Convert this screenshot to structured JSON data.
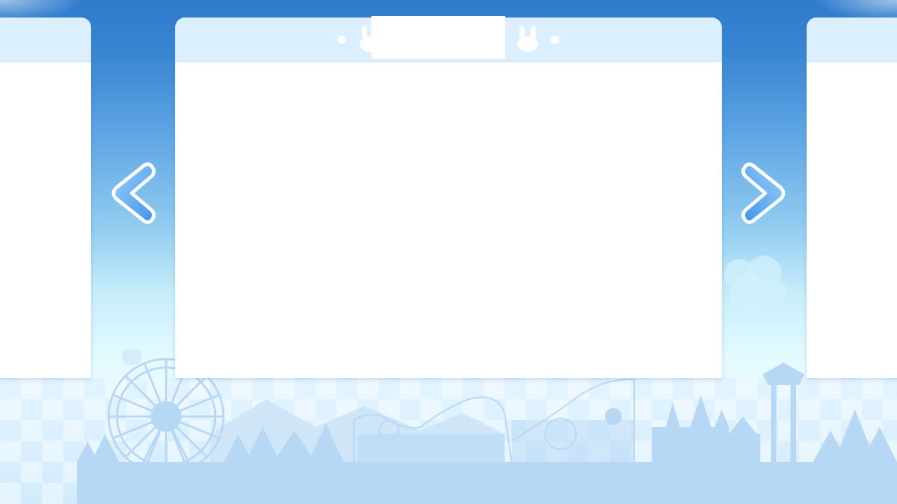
{
  "screen": {
    "title": "",
    "icons": {
      "prev": "chevron-left-icon",
      "next": "chevron-right-icon",
      "decoration": "bunny-icon"
    }
  },
  "colors": {
    "sky_top": "#2f7bcc",
    "sky_bottom": "#e6fbff",
    "panel_header": "#dcefff",
    "panel_body": "#ffffff",
    "arrow_fill": "#5aa9f0",
    "skyline": "#b7d8f5"
  },
  "carousel": {
    "panels": [
      {
        "position": "left",
        "content": ""
      },
      {
        "position": "center",
        "content": ""
      },
      {
        "position": "right",
        "content": ""
      }
    ]
  }
}
